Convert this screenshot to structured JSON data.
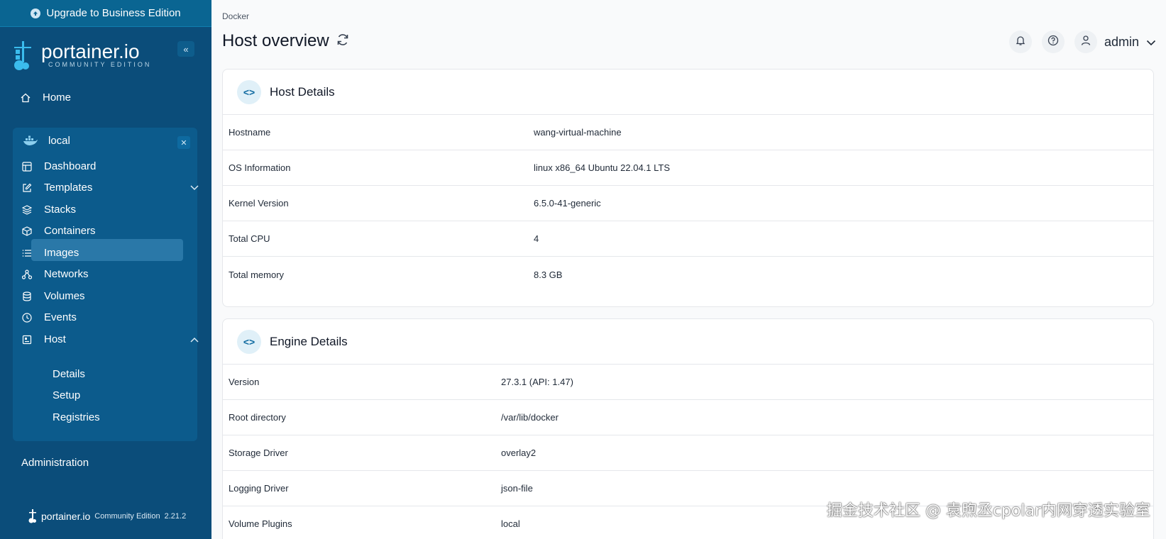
{
  "sidebar": {
    "upgrade": "Upgrade to Business Edition",
    "logo": "portainer.io",
    "logo_sub": "COMMUNITY EDITION",
    "home": "Home",
    "environment": "local",
    "items": [
      {
        "label": "Dashboard",
        "icon": "dashboard-icon"
      },
      {
        "label": "Templates",
        "icon": "edit-icon"
      },
      {
        "label": "Stacks",
        "icon": "layers-icon"
      },
      {
        "label": "Containers",
        "icon": "box-icon"
      },
      {
        "label": "Images",
        "icon": "list-icon"
      },
      {
        "label": "Networks",
        "icon": "network-icon"
      },
      {
        "label": "Volumes",
        "icon": "database-icon"
      },
      {
        "label": "Events",
        "icon": "clock-icon"
      },
      {
        "label": "Host",
        "icon": "host-icon"
      }
    ],
    "host_sub": [
      "Details",
      "Setup",
      "Registries"
    ],
    "administration": "Administration",
    "footer_logo": "portainer.io",
    "footer_edition": "Community Edition",
    "footer_version": "2.21.2"
  },
  "header": {
    "breadcrumb": "Docker",
    "title": "Host overview",
    "user": "admin"
  },
  "host_details": {
    "title": "Host Details",
    "rows": [
      {
        "key": "Hostname",
        "value": "wang-virtual-machine"
      },
      {
        "key": "OS Information",
        "value": "linux x86_64 Ubuntu 22.04.1 LTS"
      },
      {
        "key": "Kernel Version",
        "value": "6.5.0-41-generic"
      },
      {
        "key": "Total CPU",
        "value": "4"
      },
      {
        "key": "Total memory",
        "value": "8.3 GB"
      }
    ]
  },
  "engine_details": {
    "title": "Engine Details",
    "rows": [
      {
        "key": "Version",
        "value": "27.3.1 (API: 1.47)"
      },
      {
        "key": "Root directory",
        "value": "/var/lib/docker"
      },
      {
        "key": "Storage Driver",
        "value": "overlay2"
      },
      {
        "key": "Logging Driver",
        "value": "json-file"
      },
      {
        "key": "Volume Plugins",
        "value": "local"
      }
    ]
  },
  "watermark": "掘金技术社区 @ 袁煦丞cpolar内网穿透实验室"
}
